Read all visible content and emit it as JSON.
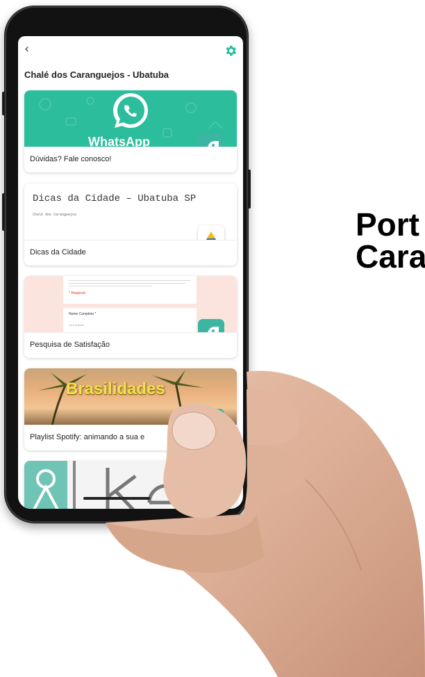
{
  "headline": {
    "line1": "Port",
    "line2": "Cara"
  },
  "app": {
    "title": "Chalé dos Caranguejos - Ubatuba",
    "back_icon": "chevron-left-icon",
    "settings_icon": "gear-icon"
  },
  "cards": [
    {
      "label": "Dúvidas? Fale conosco!",
      "badge_icon": "rocket-icon",
      "banner": "whatsapp",
      "banner_text": "WhatsApp"
    },
    {
      "label": "Dicas da Cidade",
      "badge_icon": "google-drive-icon",
      "banner": "document",
      "doc_title": "Dicas da Cidade – Ubatuba SP",
      "doc_subtitle": "Chalé dos Caranguejos"
    },
    {
      "label": "Pesquisa de Satisfação",
      "badge_icon": "rocket-icon",
      "banner": "form",
      "form_required": "* Required",
      "form_field": "Nome Completo *",
      "form_answer": "Your answer"
    },
    {
      "label": "Playlist Spotify: animando a sua e",
      "badge_icon": "rocket-icon",
      "banner": "playlist",
      "banner_text": "Brasilidades"
    }
  ],
  "colors": {
    "whatsapp": "#2bbd9c",
    "badge": "#3cb6a3",
    "form_bg": "#fbe4dd",
    "accent": "#2bbd9c"
  }
}
